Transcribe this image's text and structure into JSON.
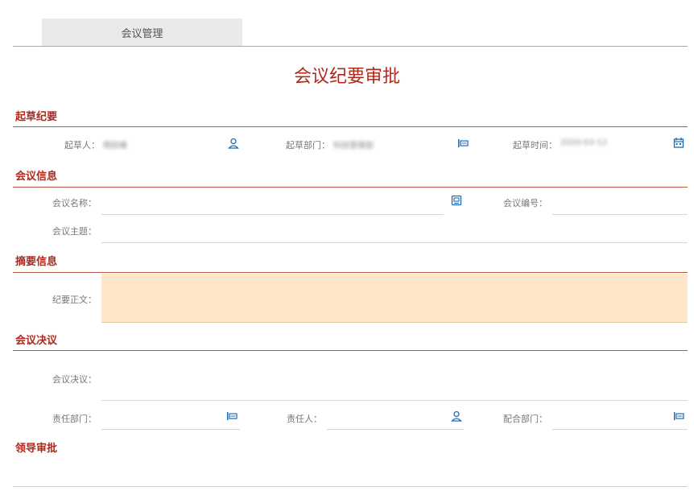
{
  "tabs": [
    {
      "label": "会议管理"
    }
  ],
  "page_title": "会议纪要审批",
  "sections": {
    "draft": "起草纪要",
    "meeting_info": "会议信息",
    "summary": "摘要信息",
    "resolution": "会议决议",
    "leader_approval": "领导审批"
  },
  "draft": {
    "drafter_label": "起草人：",
    "drafter_value": "杨跃峰",
    "dept_label": "起草部门：",
    "dept_value": "科技管理部",
    "time_label": "起草时间：",
    "time_value": "2020-03-12"
  },
  "meeting_info": {
    "name_label": "会议名称：",
    "number_label": "会议编号：",
    "topic_label": "会议主题："
  },
  "summary": {
    "body_label": "纪要正文："
  },
  "resolution": {
    "resolution_label": "会议决议：",
    "resp_dept_label": "责任部门：",
    "resp_person_label": "责任人：",
    "coop_dept_label": "配合部门："
  },
  "colors": {
    "accent": "#b0281c",
    "icon_blue": "#1f6bb5",
    "textarea_bg": "#fde7c8"
  },
  "icons": {
    "user": "user-icon",
    "department": "department-icon",
    "calendar": "calendar-icon",
    "picker": "picker-icon"
  }
}
